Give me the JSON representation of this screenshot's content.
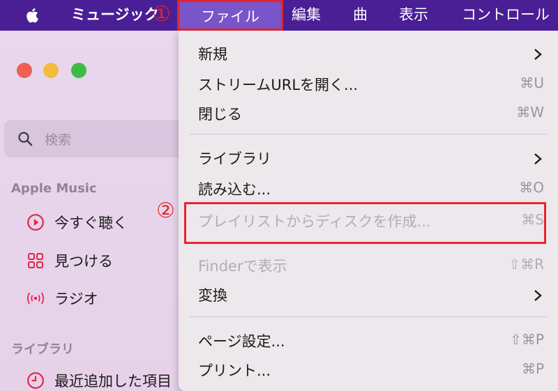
{
  "menubar": {
    "app_name": "ミュージック",
    "items": {
      "file": "ファイル",
      "edit": "編集",
      "song": "曲",
      "view": "表示",
      "controls": "コントロール"
    }
  },
  "sidebar": {
    "search_placeholder": "検索",
    "section_apple_music": "Apple Music",
    "apple_music_items": [
      {
        "label": "今すぐ聴く",
        "icon": "play-circle-icon"
      },
      {
        "label": "見つける",
        "icon": "grid-icon"
      },
      {
        "label": "ラジオ",
        "icon": "broadcast-icon"
      }
    ],
    "section_library": "ライブラリ",
    "library_items": [
      {
        "label": "最近追加した項目",
        "icon": "clock-icon"
      }
    ]
  },
  "file_menu": {
    "items": [
      {
        "label": "新規",
        "shortcut": "",
        "submenu": true,
        "enabled": true
      },
      {
        "label": "ストリームURLを開く...",
        "shortcut": "⌘U",
        "submenu": false,
        "enabled": true
      },
      {
        "label": "閉じる",
        "shortcut": "⌘W",
        "submenu": false,
        "enabled": true
      },
      {
        "label": "ライブラリ",
        "shortcut": "",
        "submenu": true,
        "enabled": true
      },
      {
        "label": "読み込む...",
        "shortcut": "⌘O",
        "submenu": false,
        "enabled": true
      },
      {
        "label": "プレイリストからディスクを作成...",
        "shortcut": "⌘S",
        "submenu": false,
        "enabled": false
      },
      {
        "label": "Finderで表示",
        "shortcut": "⇧⌘R",
        "submenu": false,
        "enabled": false
      },
      {
        "label": "変換",
        "shortcut": "",
        "submenu": true,
        "enabled": true
      },
      {
        "label": "ページ設定...",
        "shortcut": "⇧⌘P",
        "submenu": false,
        "enabled": true
      },
      {
        "label": "プリント...",
        "shortcut": "⌘P",
        "submenu": false,
        "enabled": true
      }
    ]
  },
  "annotations": {
    "step1": "①",
    "step2": "②"
  },
  "colors": {
    "menubar": "#4a1f96",
    "highlight": "#e8252f",
    "traffic_red": "#ef5f58",
    "traffic_yellow": "#f2bd3c",
    "traffic_green": "#3fbb44"
  }
}
